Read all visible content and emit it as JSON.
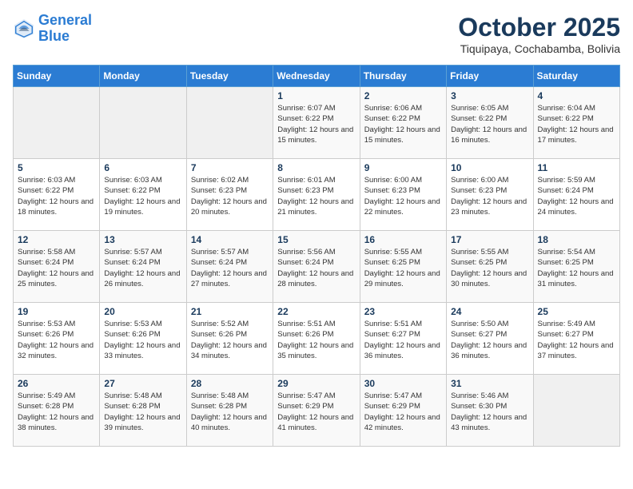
{
  "logo": {
    "line1": "General",
    "line2": "Blue"
  },
  "title": "October 2025",
  "subtitle": "Tiquipaya, Cochabamba, Bolivia",
  "weekdays": [
    "Sunday",
    "Monday",
    "Tuesday",
    "Wednesday",
    "Thursday",
    "Friday",
    "Saturday"
  ],
  "weeks": [
    [
      {
        "day": "",
        "sunrise": "",
        "sunset": "",
        "daylight": ""
      },
      {
        "day": "",
        "sunrise": "",
        "sunset": "",
        "daylight": ""
      },
      {
        "day": "",
        "sunrise": "",
        "sunset": "",
        "daylight": ""
      },
      {
        "day": "1",
        "sunrise": "Sunrise: 6:07 AM",
        "sunset": "Sunset: 6:22 PM",
        "daylight": "Daylight: 12 hours and 15 minutes."
      },
      {
        "day": "2",
        "sunrise": "Sunrise: 6:06 AM",
        "sunset": "Sunset: 6:22 PM",
        "daylight": "Daylight: 12 hours and 15 minutes."
      },
      {
        "day": "3",
        "sunrise": "Sunrise: 6:05 AM",
        "sunset": "Sunset: 6:22 PM",
        "daylight": "Daylight: 12 hours and 16 minutes."
      },
      {
        "day": "4",
        "sunrise": "Sunrise: 6:04 AM",
        "sunset": "Sunset: 6:22 PM",
        "daylight": "Daylight: 12 hours and 17 minutes."
      }
    ],
    [
      {
        "day": "5",
        "sunrise": "Sunrise: 6:03 AM",
        "sunset": "Sunset: 6:22 PM",
        "daylight": "Daylight: 12 hours and 18 minutes."
      },
      {
        "day": "6",
        "sunrise": "Sunrise: 6:03 AM",
        "sunset": "Sunset: 6:22 PM",
        "daylight": "Daylight: 12 hours and 19 minutes."
      },
      {
        "day": "7",
        "sunrise": "Sunrise: 6:02 AM",
        "sunset": "Sunset: 6:23 PM",
        "daylight": "Daylight: 12 hours and 20 minutes."
      },
      {
        "day": "8",
        "sunrise": "Sunrise: 6:01 AM",
        "sunset": "Sunset: 6:23 PM",
        "daylight": "Daylight: 12 hours and 21 minutes."
      },
      {
        "day": "9",
        "sunrise": "Sunrise: 6:00 AM",
        "sunset": "Sunset: 6:23 PM",
        "daylight": "Daylight: 12 hours and 22 minutes."
      },
      {
        "day": "10",
        "sunrise": "Sunrise: 6:00 AM",
        "sunset": "Sunset: 6:23 PM",
        "daylight": "Daylight: 12 hours and 23 minutes."
      },
      {
        "day": "11",
        "sunrise": "Sunrise: 5:59 AM",
        "sunset": "Sunset: 6:24 PM",
        "daylight": "Daylight: 12 hours and 24 minutes."
      }
    ],
    [
      {
        "day": "12",
        "sunrise": "Sunrise: 5:58 AM",
        "sunset": "Sunset: 6:24 PM",
        "daylight": "Daylight: 12 hours and 25 minutes."
      },
      {
        "day": "13",
        "sunrise": "Sunrise: 5:57 AM",
        "sunset": "Sunset: 6:24 PM",
        "daylight": "Daylight: 12 hours and 26 minutes."
      },
      {
        "day": "14",
        "sunrise": "Sunrise: 5:57 AM",
        "sunset": "Sunset: 6:24 PM",
        "daylight": "Daylight: 12 hours and 27 minutes."
      },
      {
        "day": "15",
        "sunrise": "Sunrise: 5:56 AM",
        "sunset": "Sunset: 6:24 PM",
        "daylight": "Daylight: 12 hours and 28 minutes."
      },
      {
        "day": "16",
        "sunrise": "Sunrise: 5:55 AM",
        "sunset": "Sunset: 6:25 PM",
        "daylight": "Daylight: 12 hours and 29 minutes."
      },
      {
        "day": "17",
        "sunrise": "Sunrise: 5:55 AM",
        "sunset": "Sunset: 6:25 PM",
        "daylight": "Daylight: 12 hours and 30 minutes."
      },
      {
        "day": "18",
        "sunrise": "Sunrise: 5:54 AM",
        "sunset": "Sunset: 6:25 PM",
        "daylight": "Daylight: 12 hours and 31 minutes."
      }
    ],
    [
      {
        "day": "19",
        "sunrise": "Sunrise: 5:53 AM",
        "sunset": "Sunset: 6:26 PM",
        "daylight": "Daylight: 12 hours and 32 minutes."
      },
      {
        "day": "20",
        "sunrise": "Sunrise: 5:53 AM",
        "sunset": "Sunset: 6:26 PM",
        "daylight": "Daylight: 12 hours and 33 minutes."
      },
      {
        "day": "21",
        "sunrise": "Sunrise: 5:52 AM",
        "sunset": "Sunset: 6:26 PM",
        "daylight": "Daylight: 12 hours and 34 minutes."
      },
      {
        "day": "22",
        "sunrise": "Sunrise: 5:51 AM",
        "sunset": "Sunset: 6:26 PM",
        "daylight": "Daylight: 12 hours and 35 minutes."
      },
      {
        "day": "23",
        "sunrise": "Sunrise: 5:51 AM",
        "sunset": "Sunset: 6:27 PM",
        "daylight": "Daylight: 12 hours and 36 minutes."
      },
      {
        "day": "24",
        "sunrise": "Sunrise: 5:50 AM",
        "sunset": "Sunset: 6:27 PM",
        "daylight": "Daylight: 12 hours and 36 minutes."
      },
      {
        "day": "25",
        "sunrise": "Sunrise: 5:49 AM",
        "sunset": "Sunset: 6:27 PM",
        "daylight": "Daylight: 12 hours and 37 minutes."
      }
    ],
    [
      {
        "day": "26",
        "sunrise": "Sunrise: 5:49 AM",
        "sunset": "Sunset: 6:28 PM",
        "daylight": "Daylight: 12 hours and 38 minutes."
      },
      {
        "day": "27",
        "sunrise": "Sunrise: 5:48 AM",
        "sunset": "Sunset: 6:28 PM",
        "daylight": "Daylight: 12 hours and 39 minutes."
      },
      {
        "day": "28",
        "sunrise": "Sunrise: 5:48 AM",
        "sunset": "Sunset: 6:28 PM",
        "daylight": "Daylight: 12 hours and 40 minutes."
      },
      {
        "day": "29",
        "sunrise": "Sunrise: 5:47 AM",
        "sunset": "Sunset: 6:29 PM",
        "daylight": "Daylight: 12 hours and 41 minutes."
      },
      {
        "day": "30",
        "sunrise": "Sunrise: 5:47 AM",
        "sunset": "Sunset: 6:29 PM",
        "daylight": "Daylight: 12 hours and 42 minutes."
      },
      {
        "day": "31",
        "sunrise": "Sunrise: 5:46 AM",
        "sunset": "Sunset: 6:30 PM",
        "daylight": "Daylight: 12 hours and 43 minutes."
      },
      {
        "day": "",
        "sunrise": "",
        "sunset": "",
        "daylight": ""
      }
    ]
  ]
}
